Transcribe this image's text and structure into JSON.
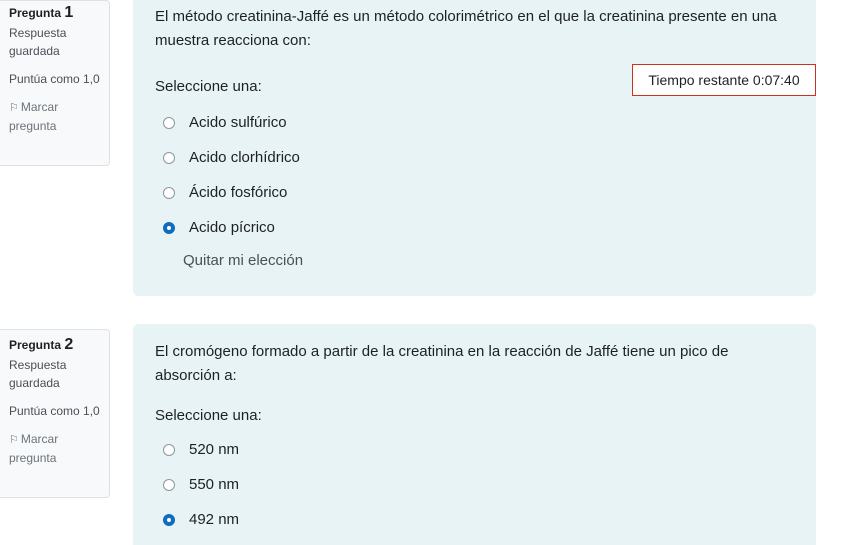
{
  "timer": {
    "label": "Tiempo restante",
    "value": "0:07:40"
  },
  "questions": [
    {
      "prefix": "Pregunta",
      "number": "1",
      "state": "Respuesta guardada",
      "grade": "Puntúa como 1,0",
      "flag": "Marcar pregunta",
      "text": "El método creatinina-Jaffé es un método colorimétrico en el que la creatinina presente en una muestra reacciona con:",
      "prompt": "Seleccione una:",
      "options": [
        "Acido sulfúrico",
        "Acido clorhídrico",
        "Ácido fosfórico",
        "Acido pícrico"
      ],
      "selected": 3,
      "clear": "Quitar mi elección"
    },
    {
      "prefix": "Pregunta",
      "number": "2",
      "state": "Respuesta guardada",
      "grade": "Puntúa como 1,0",
      "flag": "Marcar pregunta",
      "text": "El cromógeno formado a partir de la creatinina en la reacción de Jaffé tiene un pico de absorción a:",
      "prompt": "Seleccione una:",
      "options": [
        "520 nm",
        "550 nm",
        "492 nm"
      ],
      "selected": 2
    }
  ]
}
